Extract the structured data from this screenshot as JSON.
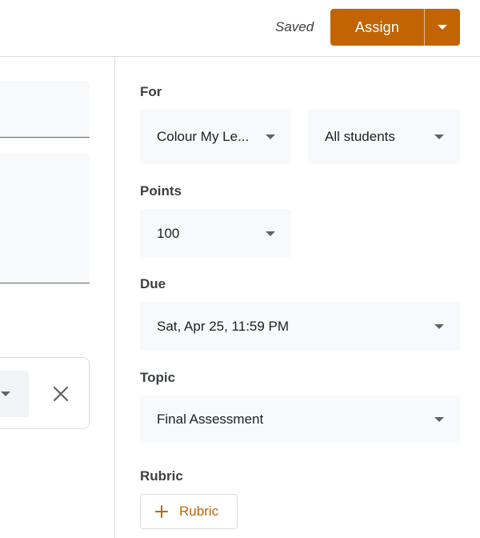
{
  "header": {
    "status": "Saved",
    "assign_label": "Assign",
    "assign_color": "#c26401"
  },
  "settings": {
    "for_label": "For",
    "class_value": "Colour My Le...",
    "students_value": "All students",
    "points_label": "Points",
    "points_value": "100",
    "due_label": "Due",
    "due_value": "Sat, Apr 25, 11:59 PM",
    "topic_label": "Topic",
    "topic_value": "Final Assessment",
    "rubric_label": "Rubric",
    "rubric_button": "Rubric"
  },
  "icons": [
    "caret-down-icon",
    "close-icon",
    "plus-icon"
  ]
}
